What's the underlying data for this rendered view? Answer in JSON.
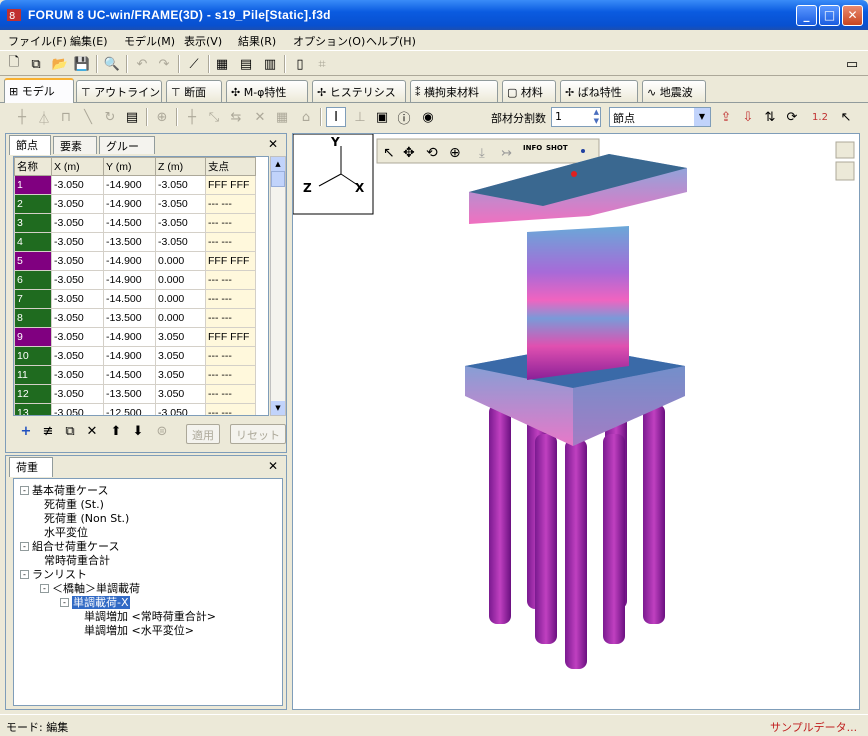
{
  "window": {
    "title": "FORUM 8   UC-win/FRAME(3D) - s19_Pile[Static].f3d"
  },
  "menu": [
    "ファイル(F)",
    "編集(E)",
    "モデル(M)",
    "表示(V)",
    "結果(R)",
    "オプション(O)",
    "ヘルプ(H)"
  ],
  "tabs": [
    "モデル",
    "アウトライン",
    "断面",
    "M-φ特性",
    "ヒステリシス",
    "横拘束材料",
    "材料",
    "ばね特性",
    "地震波"
  ],
  "toolbar2": {
    "division_label": "部材分割数",
    "division_value": "1",
    "select_value": "節点"
  },
  "left_panel": {
    "subtabs": [
      "節点",
      "要素",
      "グループ"
    ],
    "columns": [
      "名称",
      "X (m)",
      "Y (m)",
      "Z (m)",
      "支点"
    ],
    "rows": [
      {
        "id": "1",
        "x": "-3.050",
        "y": "-14.900",
        "z": "-3.050",
        "support": "FFF FFF",
        "color": "#800080"
      },
      {
        "id": "2",
        "x": "-3.050",
        "y": "-14.900",
        "z": "-3.050",
        "support": "--- ---",
        "color": "#1f6b1f"
      },
      {
        "id": "3",
        "x": "-3.050",
        "y": "-14.500",
        "z": "-3.050",
        "support": "--- ---",
        "color": "#1f6b1f"
      },
      {
        "id": "4",
        "x": "-3.050",
        "y": "-13.500",
        "z": "-3.050",
        "support": "--- ---",
        "color": "#1f6b1f"
      },
      {
        "id": "5",
        "x": "-3.050",
        "y": "-14.900",
        "z": "0.000",
        "support": "FFF FFF",
        "color": "#800080"
      },
      {
        "id": "6",
        "x": "-3.050",
        "y": "-14.900",
        "z": "0.000",
        "support": "--- ---",
        "color": "#1f6b1f"
      },
      {
        "id": "7",
        "x": "-3.050",
        "y": "-14.500",
        "z": "0.000",
        "support": "--- ---",
        "color": "#1f6b1f"
      },
      {
        "id": "8",
        "x": "-3.050",
        "y": "-13.500",
        "z": "0.000",
        "support": "--- ---",
        "color": "#1f6b1f"
      },
      {
        "id": "9",
        "x": "-3.050",
        "y": "-14.900",
        "z": "3.050",
        "support": "FFF FFF",
        "color": "#800080"
      },
      {
        "id": "10",
        "x": "-3.050",
        "y": "-14.900",
        "z": "3.050",
        "support": "--- ---",
        "color": "#1f6b1f"
      },
      {
        "id": "11",
        "x": "-3.050",
        "y": "-14.500",
        "z": "3.050",
        "support": "--- ---",
        "color": "#1f6b1f"
      },
      {
        "id": "12",
        "x": "-3.050",
        "y": "-13.500",
        "z": "3.050",
        "support": "--- ---",
        "color": "#1f6b1f"
      },
      {
        "id": "13",
        "x": "-3.050",
        "y": "-12.500",
        "z": "-3.050",
        "support": "--- ---",
        "color": "#1f6b1f"
      }
    ],
    "apply_label": "適用",
    "reset_label": "リセット"
  },
  "load_panel": {
    "tab": "荷重",
    "tree": [
      {
        "label": "基本荷重ケース",
        "level": 0,
        "expand": "-"
      },
      {
        "label": "死荷重 (St.)",
        "level": 1
      },
      {
        "label": "死荷重 (Non St.)",
        "level": 1
      },
      {
        "label": "水平変位",
        "level": 1
      },
      {
        "label": "組合せ荷重ケース",
        "level": 0,
        "expand": "-"
      },
      {
        "label": "常時荷重合計",
        "level": 1
      },
      {
        "label": "ランリスト",
        "level": 0,
        "expand": "-"
      },
      {
        "label": "＜橋軸＞単調載荷",
        "level": 1,
        "expand": "-"
      },
      {
        "label": "単調載荷-X",
        "level": 2,
        "expand": "-",
        "selected": true
      },
      {
        "label": "単調増加 <常時荷重合計>",
        "level": 3
      },
      {
        "label": "単調増加 <水平変位>",
        "level": 3
      }
    ]
  },
  "viewport": {
    "axes": {
      "y": "Y",
      "z": "Z",
      "x": "X"
    },
    "info_label": "INFO",
    "shot_label": "SHOT"
  },
  "status": {
    "mode": "モード: 編集",
    "right": "サンプルデータ..."
  }
}
